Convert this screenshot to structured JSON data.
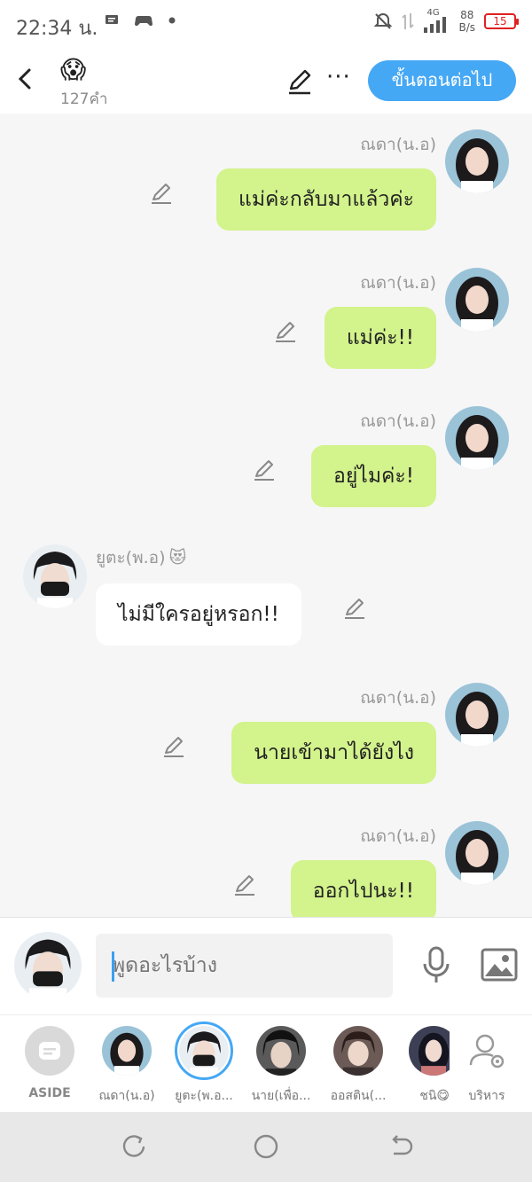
{
  "status_bar": {
    "time": "22:34 น.",
    "network": "4G",
    "speed_value": "88",
    "speed_unit": "B/s",
    "battery": "15"
  },
  "header": {
    "emoji": "😱",
    "word_count": "127คำ",
    "next_button": "ขั้นตอนต่อไป",
    "more": "···"
  },
  "messages": [
    {
      "side": "right",
      "name": "ณดา(น.อ)",
      "text": "แม่ค่ะกลับมาแล้วค่ะ"
    },
    {
      "side": "right",
      "name": "ณดา(น.อ)",
      "text": "แม่ค่ะ!!"
    },
    {
      "side": "right",
      "name": "ณดา(น.อ)",
      "text": "อยู่ไมค่ะ!"
    },
    {
      "side": "left",
      "name": "ยูตะ(พ.อ)",
      "name_emoji": "😻",
      "text": "ไม่มีใครอยู่หรอก!!"
    },
    {
      "side": "right",
      "name": "ณดา(น.อ)",
      "text": "นายเข้ามาได้ยังไง"
    },
    {
      "side": "right",
      "name": "ณดา(น.อ)",
      "text": "ออกไปนะ!!"
    }
  ],
  "input": {
    "placeholder": "พูดอะไรบ้าง"
  },
  "characters": [
    {
      "label": "ASIDE"
    },
    {
      "label": "ณดา(น.อ)"
    },
    {
      "label": "ยูตะ(พ.อ..."
    },
    {
      "label": "นาย(เพื่อ..."
    },
    {
      "label": "ออสติน(..."
    },
    {
      "label": "ชนิ😋"
    },
    {
      "label": "บริหาร"
    }
  ],
  "colors": {
    "accent": "#45a8f5",
    "bubble_user": "#d3f38c",
    "bubble_other": "#ffffff",
    "background": "#f6f6f6"
  }
}
